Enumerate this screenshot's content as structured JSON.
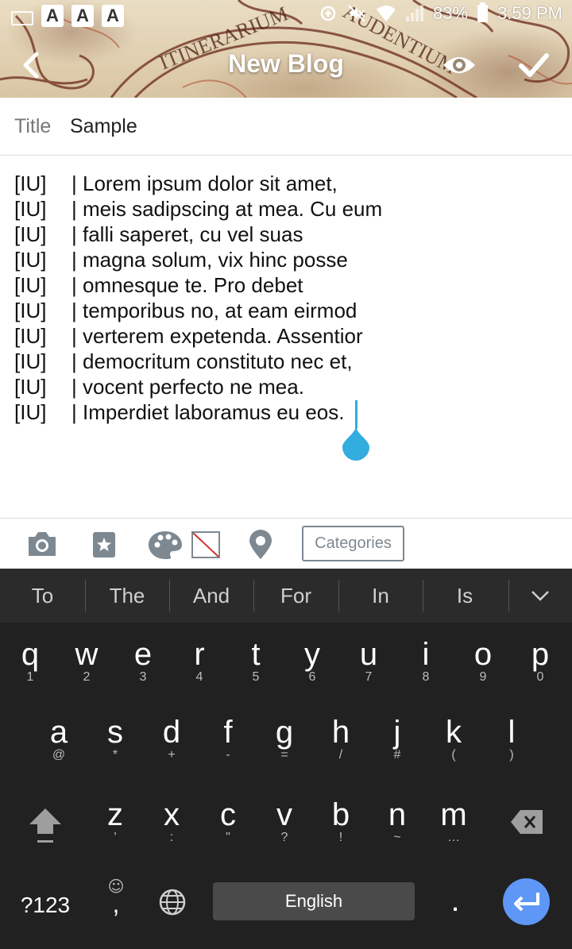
{
  "status_bar": {
    "app_icons": [
      "A",
      "A",
      "A"
    ],
    "battery": "83%",
    "time": "3:59 PM"
  },
  "header": {
    "title": "New Blog",
    "banner_text_left": "ITINERARIUM",
    "banner_text_right": "AUDENTIUM"
  },
  "title_field": {
    "label": "Title",
    "value": "Sample"
  },
  "body_lines": [
    {
      "tag": "[IU]",
      "text": "| Lorem ipsum dolor sit amet,"
    },
    {
      "tag": "[IU]",
      "text": "| meis sadipscing at mea. Cu eum"
    },
    {
      "tag": "[IU]",
      "text": "| falli saperet, cu vel suas"
    },
    {
      "tag": "[IU]",
      "text": "| magna solum, vix hinc posse"
    },
    {
      "tag": "[IU]",
      "text": "| omnesque te. Pro debet"
    },
    {
      "tag": "[IU]",
      "text": "| temporibus no, at eam eirmod"
    },
    {
      "tag": "[IU]",
      "text": "| verterem expetenda. Assentior"
    },
    {
      "tag": "[IU]",
      "text": "| democritum constituto nec et,"
    },
    {
      "tag": "[IU]",
      "text": "| vocent perfecto ne mea."
    },
    {
      "tag": "[IU]",
      "text": "| Imperdiet laboramus eu eos."
    }
  ],
  "toolbar": {
    "categories_label": "Categories"
  },
  "keyboard": {
    "suggestions": [
      "To",
      "The",
      "And",
      "For",
      "In",
      "Is"
    ],
    "row1": [
      {
        "m": "q",
        "s": "1"
      },
      {
        "m": "w",
        "s": "2"
      },
      {
        "m": "e",
        "s": "3"
      },
      {
        "m": "r",
        "s": "4"
      },
      {
        "m": "t",
        "s": "5"
      },
      {
        "m": "y",
        "s": "6"
      },
      {
        "m": "u",
        "s": "7"
      },
      {
        "m": "i",
        "s": "8"
      },
      {
        "m": "o",
        "s": "9"
      },
      {
        "m": "p",
        "s": "0"
      }
    ],
    "row2": [
      {
        "m": "a",
        "s": "@"
      },
      {
        "m": "s",
        "s": "*"
      },
      {
        "m": "d",
        "s": "+"
      },
      {
        "m": "f",
        "s": "-"
      },
      {
        "m": "g",
        "s": "="
      },
      {
        "m": "h",
        "s": "/"
      },
      {
        "m": "j",
        "s": "#"
      },
      {
        "m": "k",
        "s": "("
      },
      {
        "m": "l",
        "s": ")"
      }
    ],
    "row3": [
      {
        "m": "z",
        "s": "'"
      },
      {
        "m": "x",
        "s": ":"
      },
      {
        "m": "c",
        "s": "\""
      },
      {
        "m": "v",
        "s": "?"
      },
      {
        "m": "b",
        "s": "!"
      },
      {
        "m": "n",
        "s": "~"
      },
      {
        "m": "m",
        "s": "…"
      }
    ],
    "symbols_key": "?123",
    "comma_key": ",",
    "emoji_icon": "☺",
    "space_label": "English",
    "period_key": "."
  }
}
